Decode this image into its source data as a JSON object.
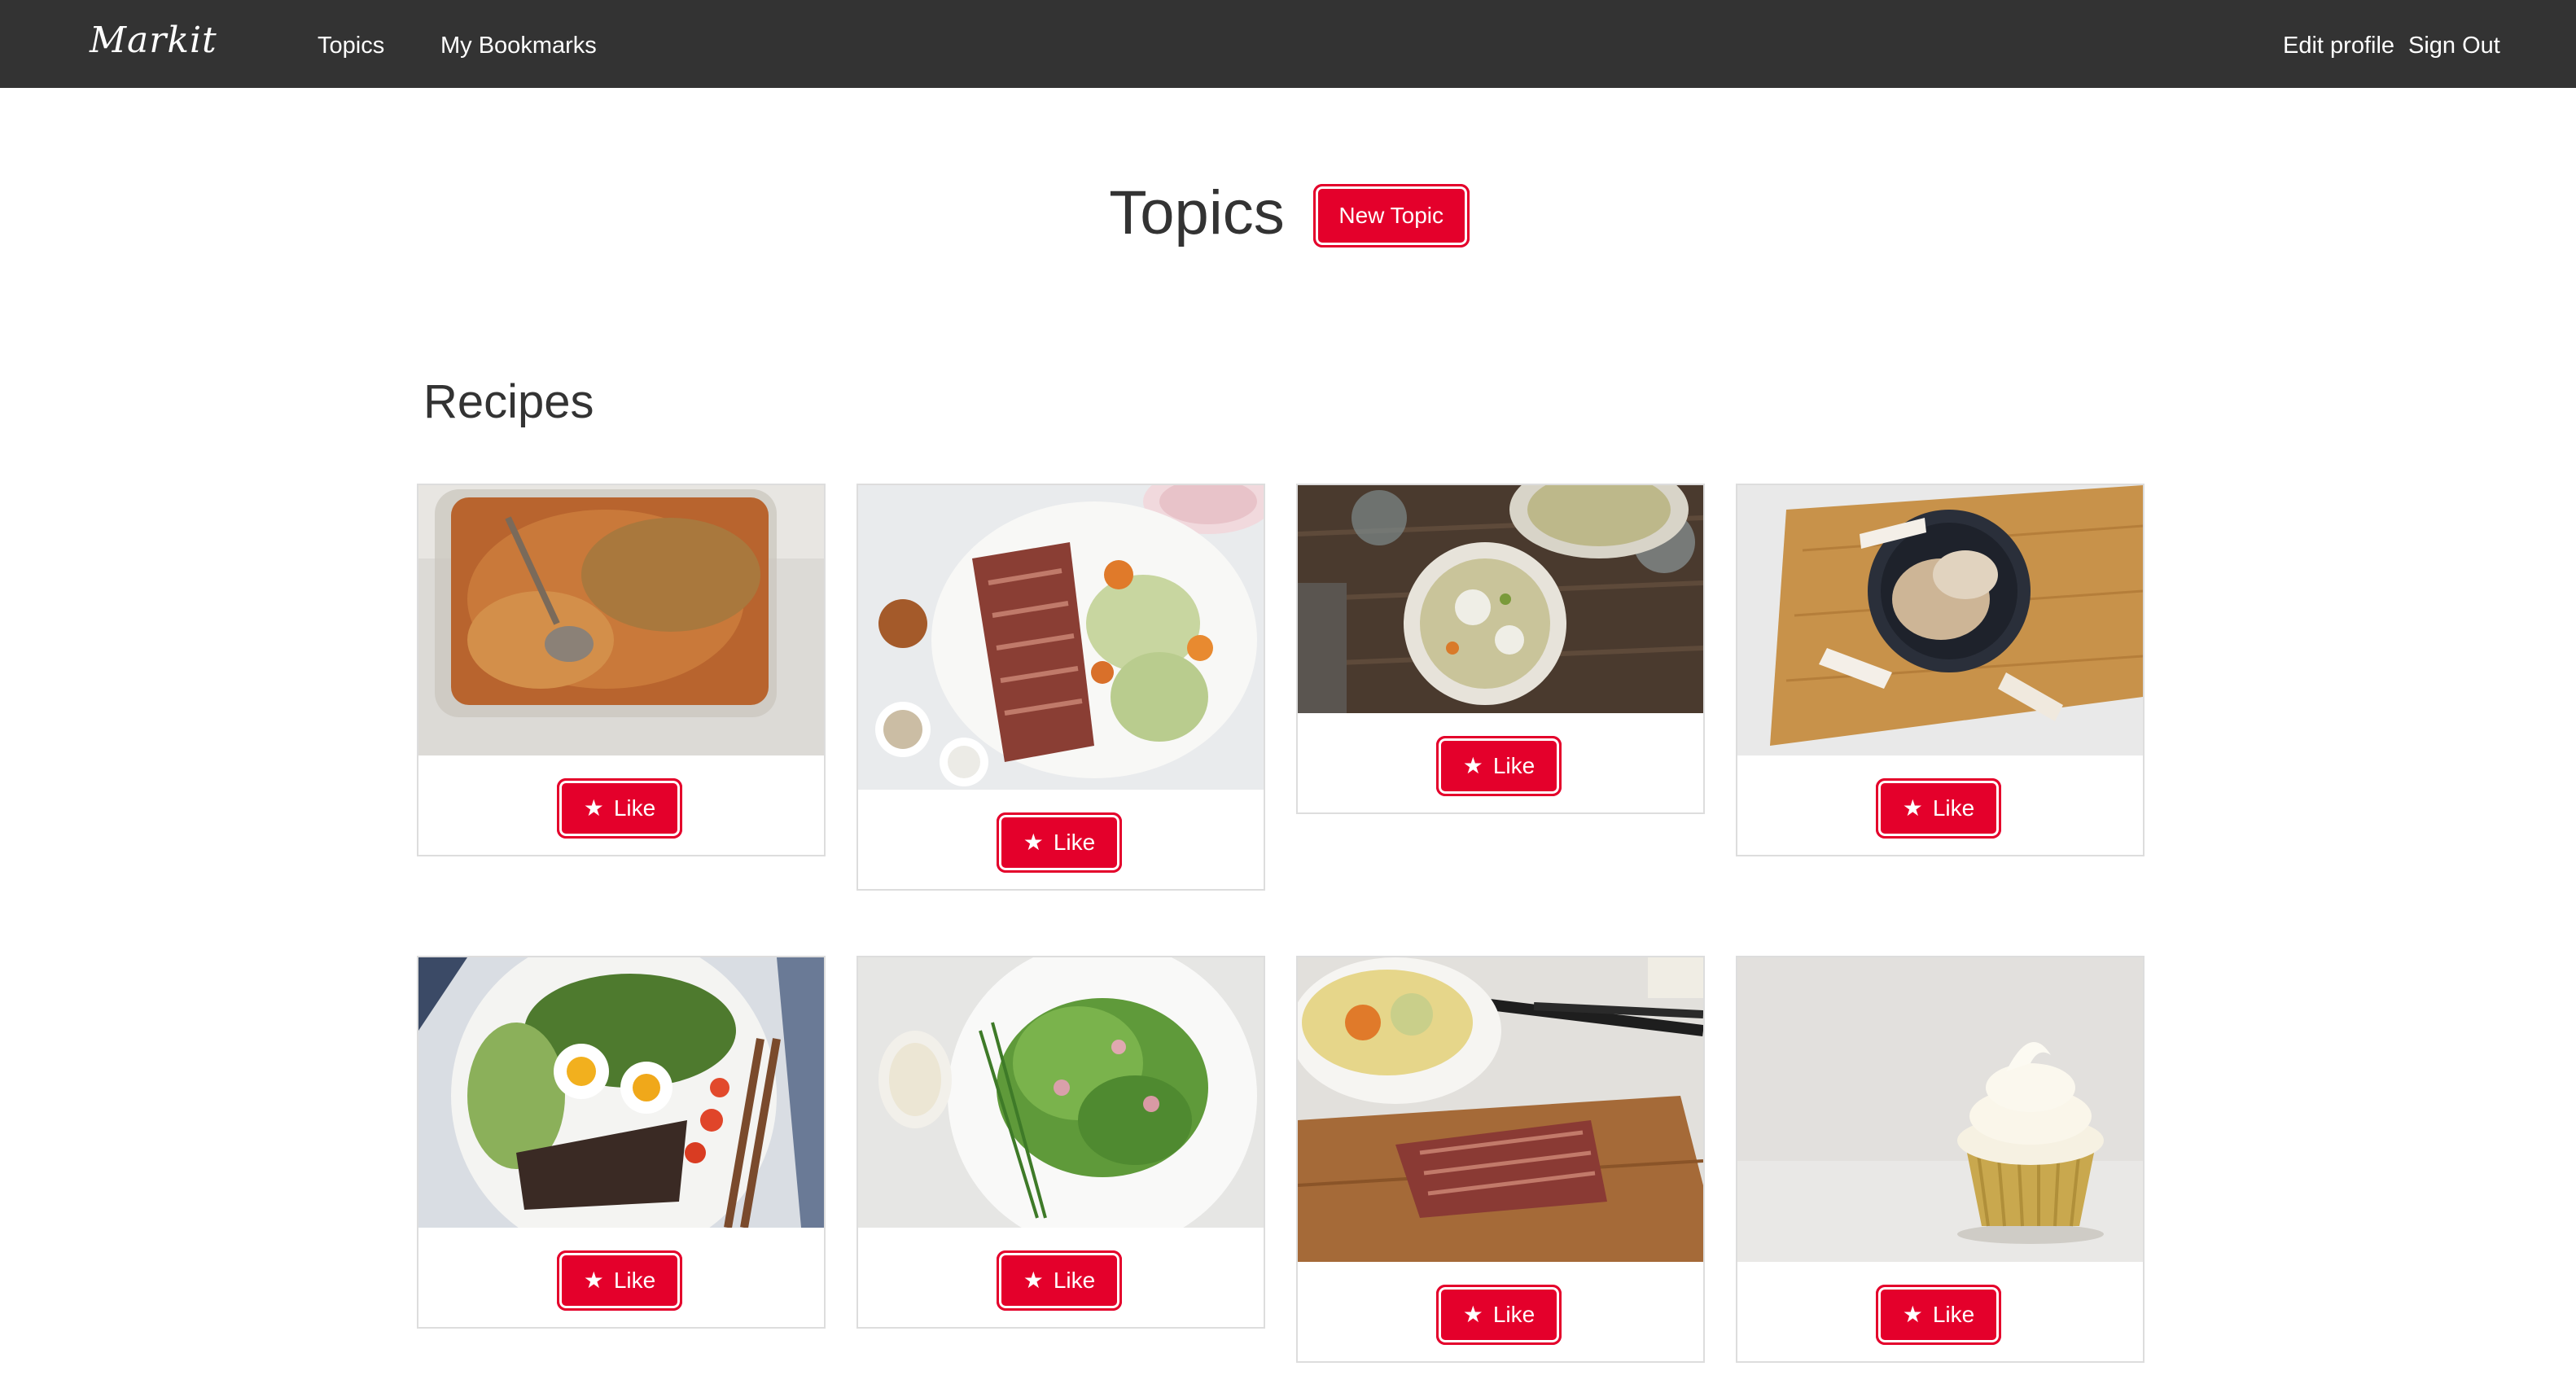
{
  "navbar": {
    "brand": "Markit",
    "links": [
      {
        "label": "Topics"
      },
      {
        "label": "My Bookmarks"
      }
    ],
    "right_links": [
      {
        "label": "Edit profile"
      },
      {
        "label": "Sign Out"
      }
    ]
  },
  "page": {
    "title": "Topics",
    "new_topic_label": "New Topic"
  },
  "section": {
    "title": "Recipes"
  },
  "cards": [
    {
      "image": "baked casserole dish",
      "like_label": "Like",
      "like_icon": "star-icon"
    },
    {
      "image": "sliced corned beef with vegetables",
      "like_label": "Like",
      "like_icon": "star-icon"
    },
    {
      "image": "bowls of stew with dumplings",
      "like_label": "Like",
      "like_icon": "star-icon"
    },
    {
      "image": "coconut chips in a bowl",
      "like_label": "Like",
      "like_icon": "star-icon"
    },
    {
      "image": "salad with eggs and steak",
      "like_label": "Like",
      "like_icon": "star-icon"
    },
    {
      "image": "green salad with radishes",
      "like_label": "Like",
      "like_icon": "star-icon"
    },
    {
      "image": "corned beef on cutting board",
      "like_label": "Like",
      "like_icon": "star-icon"
    },
    {
      "image": "vanilla cupcake",
      "like_label": "Like",
      "like_icon": "star-icon"
    }
  ],
  "colors": {
    "navbar": "#333333",
    "accent": "#e4002b",
    "text": "#333333"
  }
}
